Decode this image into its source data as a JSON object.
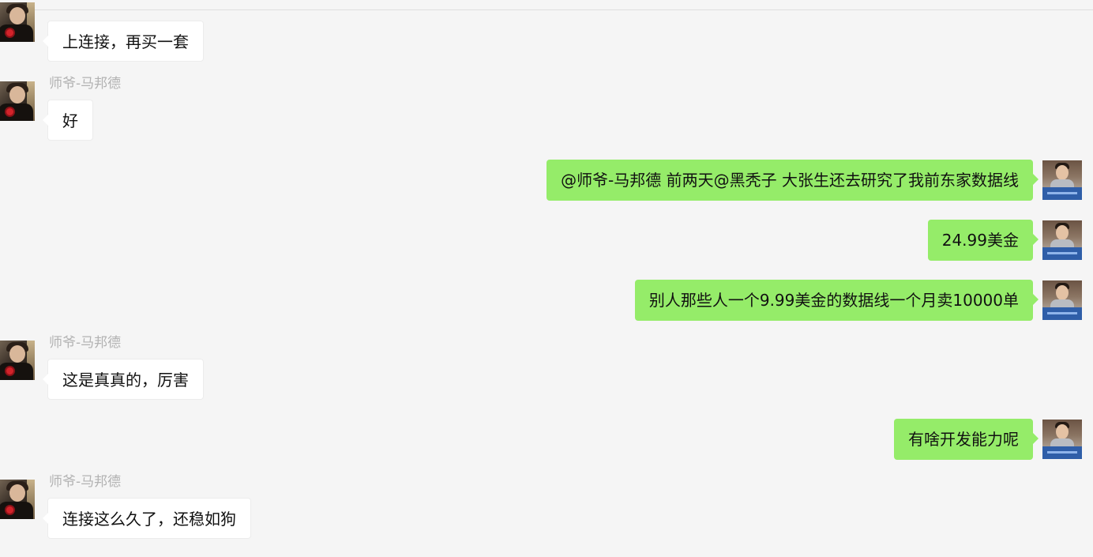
{
  "chat": {
    "messages": [
      {
        "side": "left",
        "sender": "",
        "text": "上连接，再买一套"
      },
      {
        "side": "left",
        "sender": "师爷-马邦德",
        "text": "好"
      },
      {
        "side": "right",
        "text": "@师爷-马邦德 前两天@黑秃子 大张生还去研究了我前东家数据线"
      },
      {
        "side": "right",
        "text": "24.99美金"
      },
      {
        "side": "right",
        "text": "别人那些人一个9.99美金的数据线一个月卖10000单"
      },
      {
        "side": "left",
        "sender": "师爷-马邦德",
        "text": "这是真真的，厉害"
      },
      {
        "side": "right",
        "text": "有啥开发能力呢"
      },
      {
        "side": "left",
        "sender": "师爷-马邦德",
        "text": "连接这么久了，还稳如狗"
      }
    ]
  },
  "icons": {
    "left_avatar": "user-avatar-portrait-icon",
    "right_avatar": "self-avatar-portrait-icon"
  },
  "colors": {
    "background": "#f5f5f5",
    "incoming_bubble": "#ffffff",
    "outgoing_bubble": "#95ec69",
    "sender_name": "#b2b2b2"
  }
}
